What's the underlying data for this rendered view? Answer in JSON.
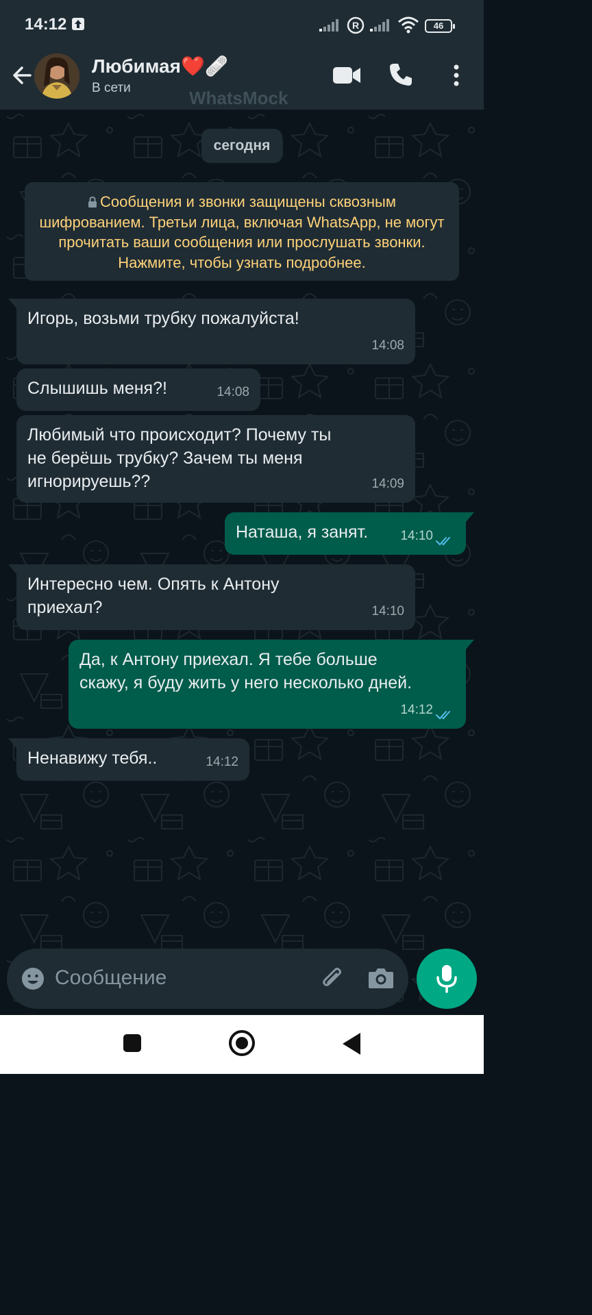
{
  "status_bar": {
    "time": "14:12",
    "battery": "46"
  },
  "header": {
    "contact_name": "Любимая❤️🩹",
    "presence": "В сети",
    "watermark": "WhatsMock"
  },
  "chat": {
    "date_label": "сегодня",
    "encryption_notice": "Сообщения и звонки защищены сквозным шифрованием. Третьи лица, включая WhatsApp, не могут прочитать ваши сообщения или прослушать звонки. Нажмите, чтобы узнать подробнее.",
    "messages": [
      {
        "direction": "in",
        "text": "Игорь, возьми трубку пожалуйста!",
        "time": "14:08"
      },
      {
        "direction": "in",
        "text": "Слышишь меня?!",
        "time": "14:08"
      },
      {
        "direction": "in",
        "text": "Любимый что происходит? Почему ты не берёшь трубку? Зачем ты меня игнорируешь??",
        "time": "14:09"
      },
      {
        "direction": "out",
        "text": "Наташа, я занят.",
        "time": "14:10",
        "status": "read"
      },
      {
        "direction": "in",
        "text": "Интересно чем. Опять к Антону приехал?",
        "time": "14:10"
      },
      {
        "direction": "out",
        "text": "Да, к Антону приехал. Я тебе больше скажу, я буду жить у него несколько дней.",
        "time": "14:12",
        "status": "read"
      },
      {
        "direction": "in",
        "text": "Ненавижу тебя..",
        "time": "14:12"
      }
    ]
  },
  "input": {
    "placeholder": "Сообщение"
  },
  "icons": {
    "back": "arrow-back-icon",
    "video": "video-call-icon",
    "call": "phone-icon",
    "menu": "more-vertical-icon",
    "emoji": "emoji-icon",
    "attach": "paperclip-icon",
    "camera": "camera-icon",
    "mic": "microphone-icon"
  },
  "colors": {
    "header_bg": "#1f2c34",
    "chat_bg": "#0b141a",
    "incoming_bubble": "#1f2c34",
    "outgoing_bubble": "#005c4b",
    "accent": "#00a884",
    "read_ticks": "#53bdeb",
    "notice_text": "#ffd279"
  }
}
